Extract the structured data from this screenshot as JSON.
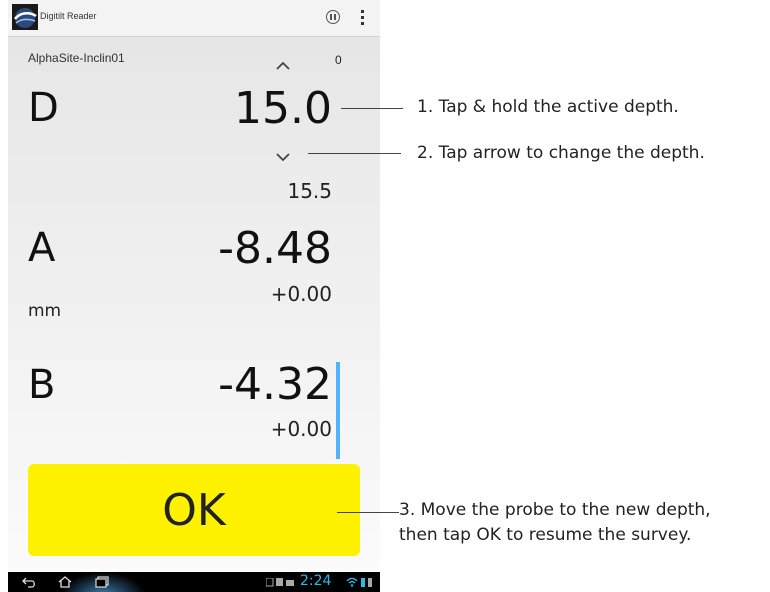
{
  "app": {
    "title": "Digitilt Reader"
  },
  "header": {
    "site_name": "AlphaSite-Inclin01",
    "counter": "0"
  },
  "depth": {
    "label": "D",
    "value": "15.0",
    "next_value": "15.5"
  },
  "reading_a": {
    "label": "A",
    "value": "-8.48",
    "delta": "+0.00",
    "unit": "mm"
  },
  "reading_b": {
    "label": "B",
    "value": "-4.32",
    "delta": "+0.00"
  },
  "ok_button": {
    "label": "OK",
    "color": "#fff200"
  },
  "status_bar": {
    "time": "2:24",
    "time_color": "#33b5e5"
  },
  "icons": [
    "app-logo-icon",
    "pause-icon",
    "overflow-menu-icon",
    "chevron-up-icon",
    "chevron-down-icon",
    "back-icon",
    "home-icon",
    "recent-apps-icon"
  ],
  "callouts": {
    "step1": "1. Tap & hold the active depth.",
    "step2": "2. Tap arrow to change the depth.",
    "step3_line1": "3. Move the probe to the new depth,",
    "step3_line2": "then tap OK to resume the survey."
  },
  "colors": {
    "accent": "#4fb3ff",
    "ok_yellow": "#fff200"
  }
}
